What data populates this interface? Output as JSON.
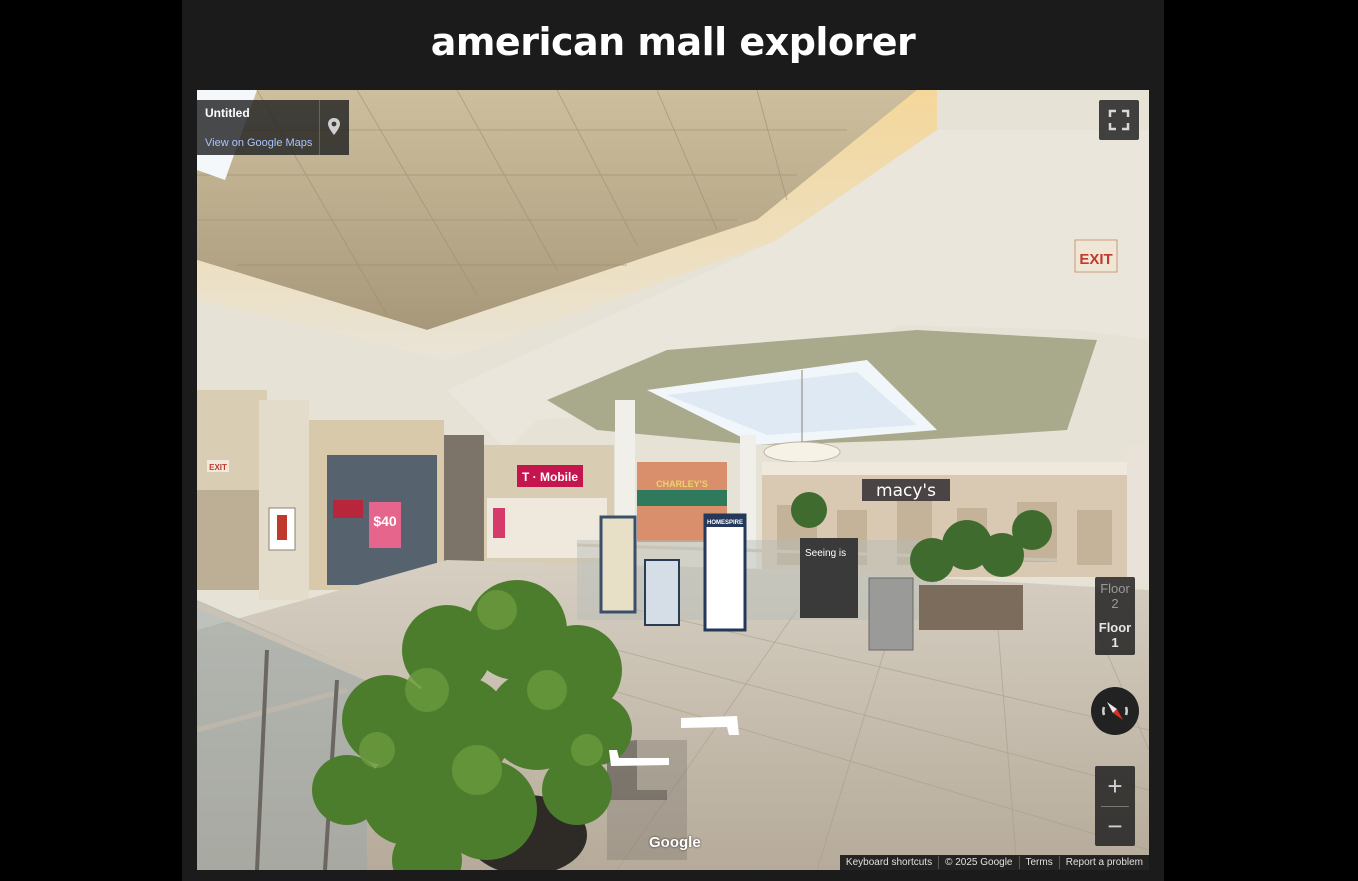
{
  "page": {
    "title": "american mall explorer"
  },
  "viewer": {
    "info": {
      "title": "Untitled",
      "link": "View on Google Maps"
    },
    "floors": [
      {
        "label": "Floor",
        "number": "2",
        "active": false
      },
      {
        "label": "Floor",
        "number": "1",
        "active": true
      }
    ],
    "zoom": {
      "in": "+",
      "out": "−"
    },
    "logo": "Google",
    "footer": {
      "shortcuts": "Keyboard shortcuts",
      "copyright": "© 2025 Google",
      "terms": "Terms",
      "report": "Report a problem"
    },
    "scene": {
      "store_tmobile": "T · Mobile",
      "store_macys": "macy's",
      "store_middle": "CHARLEY'S",
      "exit_left": "EXIT",
      "exit_right": "EXIT",
      "sale_sign": "$40",
      "kiosk_text": "Seeing is",
      "directory_sign": "HOMESPIRE"
    }
  }
}
